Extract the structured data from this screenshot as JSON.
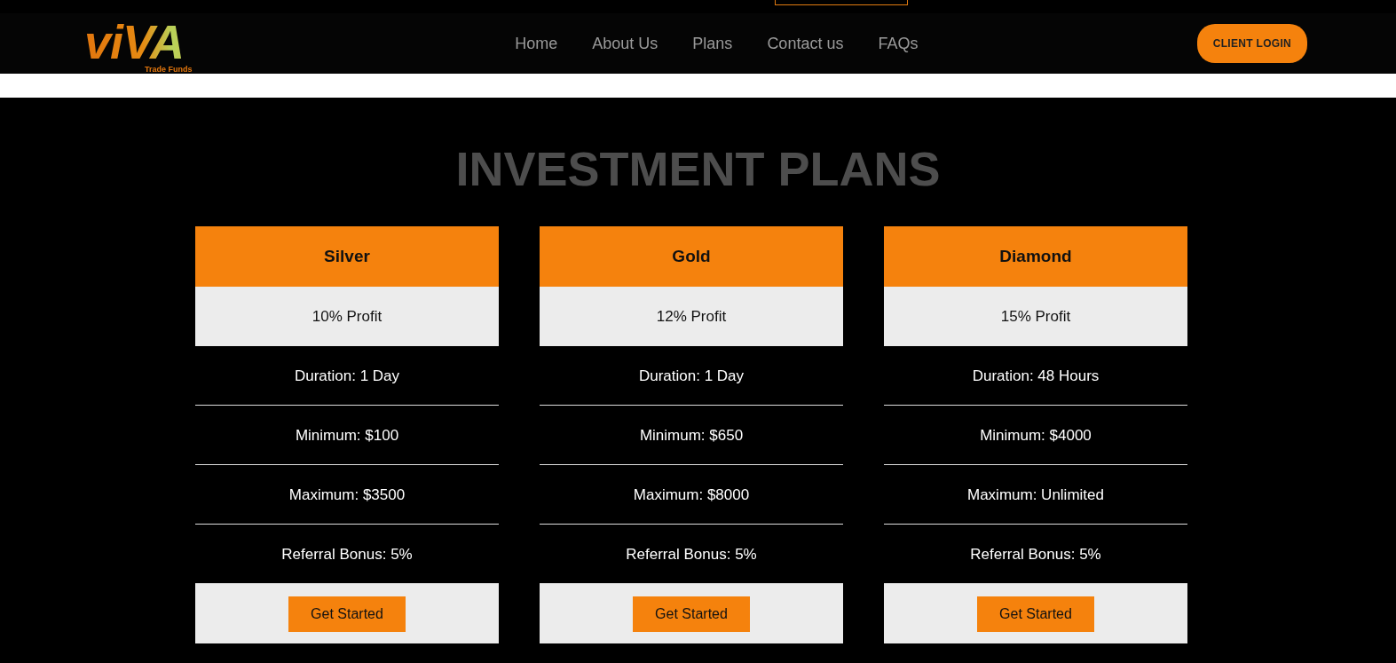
{
  "logo": {
    "name": "viVA",
    "tagline": "Trade Funds"
  },
  "nav": [
    {
      "label": "Home"
    },
    {
      "label": "About Us"
    },
    {
      "label": "Plans"
    },
    {
      "label": "Contact us"
    },
    {
      "label": "FAQs"
    }
  ],
  "login_button": "CLIENT LOGIN",
  "section_title": "INVESTMENT PLANS",
  "plans": [
    {
      "name": "Silver",
      "profit": "10% Profit",
      "details": [
        "Duration: 1 Day",
        "Minimum: $100",
        "Maximum: $3500",
        "Referral Bonus: 5%"
      ],
      "button": "Get Started"
    },
    {
      "name": "Gold",
      "profit": "12% Profit",
      "details": [
        "Duration: 1 Day",
        "Minimum: $650",
        "Maximum: $8000",
        "Referral Bonus: 5%"
      ],
      "button": "Get Started"
    },
    {
      "name": "Diamond",
      "profit": "15% Profit",
      "details": [
        "Duration: 48 Hours",
        "Minimum: $4000",
        "Maximum: Unlimited",
        "Referral Bonus: 5%"
      ],
      "button": "Get Started"
    }
  ]
}
